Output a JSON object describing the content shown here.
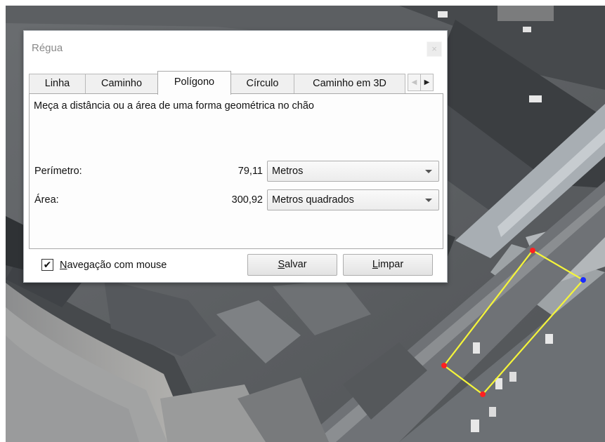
{
  "dialog": {
    "title": "Régua",
    "close_glyph": "×",
    "tabs": [
      {
        "label": "Linha",
        "active": false
      },
      {
        "label": "Caminho",
        "active": false
      },
      {
        "label": "Polígono",
        "active": true
      },
      {
        "label": "Círculo",
        "active": false
      },
      {
        "label": "Caminho em 3D",
        "active": false
      }
    ],
    "scroll_left_glyph": "◀",
    "scroll_right_glyph": "▶",
    "description": "Meça a distância ou a área de uma forma geométrica no chão",
    "perimeter": {
      "label": "Perímetro:",
      "value": "79,11",
      "unit": "Metros"
    },
    "area": {
      "label": "Área:",
      "value": "300,92",
      "unit": "Metros quadrados"
    },
    "mouse_nav": {
      "checked_glyph": "✔",
      "label_first": "N",
      "label_rest": "avegação com mouse",
      "checked": true
    },
    "save_button": {
      "first": "S",
      "rest": "alvar"
    },
    "clear_button": {
      "first": "L",
      "rest": "impar"
    }
  },
  "map": {
    "measurement_line_color": "#f5f53a",
    "vertex_colors": {
      "placed": "#ff2020",
      "active": "#1a2cff"
    }
  }
}
